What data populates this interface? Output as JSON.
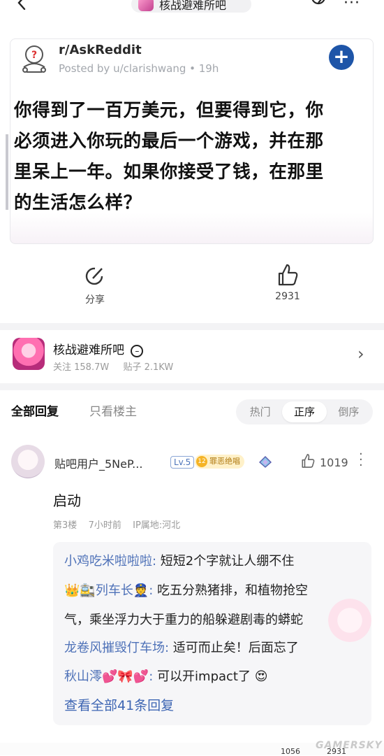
{
  "header": {
    "forum_title": "核战避难所吧"
  },
  "post_card": {
    "subreddit": "r/AskReddit",
    "posted_by": "Posted by u/clarishwang • 19h",
    "plus_label": "+",
    "lines": [
      "你得到了一百万美元，但要得到它，你",
      "必须进入你玩的最后一个游戏，并在那",
      "里呆上一年。如果你接受了钱，在那里",
      "的生活怎么样？"
    ]
  },
  "actions": {
    "share_label": "分享",
    "like_count": "2931"
  },
  "forum": {
    "name": "核战避难所吧",
    "followers": "关注 158.7W",
    "posts": "贴子 2.1KW"
  },
  "tabs": {
    "all": "全部回复",
    "host_only": "只看楼主"
  },
  "sort": {
    "hot": "热门",
    "asc": "正序",
    "desc": "倒序",
    "active": "正序"
  },
  "comment": {
    "username": "贴吧用户_5NeP...",
    "level": "Lv.5",
    "badge_num": "12",
    "badge_title": "罪恶绝唱",
    "likes": "1019",
    "text": "启动",
    "floor": "第3楼",
    "time": "7小时前",
    "ip": "IP属地:河北",
    "replies": [
      {
        "name": "小鸡吃米啦啦啦",
        "text": "短短2个字就让人绷不住"
      },
      {
        "name": "👑🚉列车长👮",
        "text": "吃五分熟猪排，和植物抢空"
      },
      {
        "name": "",
        "text": "气，乘坐浮力大于重力的船躲避剧毒的蟒蛇"
      },
      {
        "name": "龙卷风摧毁仃车场",
        "text": "适可而止矣！后面忘了"
      },
      {
        "name": "秋山澪💕🎀💕",
        "text": "可以开impact了 😍"
      }
    ],
    "view_all": "查看全部41条回复"
  },
  "bottom": {
    "left_count": "1056",
    "right_count": "2931",
    "watermark": "GAMERSKY"
  },
  "colors": {
    "link_blue": "#4f72b8",
    "accent_blue": "#1e55a8"
  }
}
